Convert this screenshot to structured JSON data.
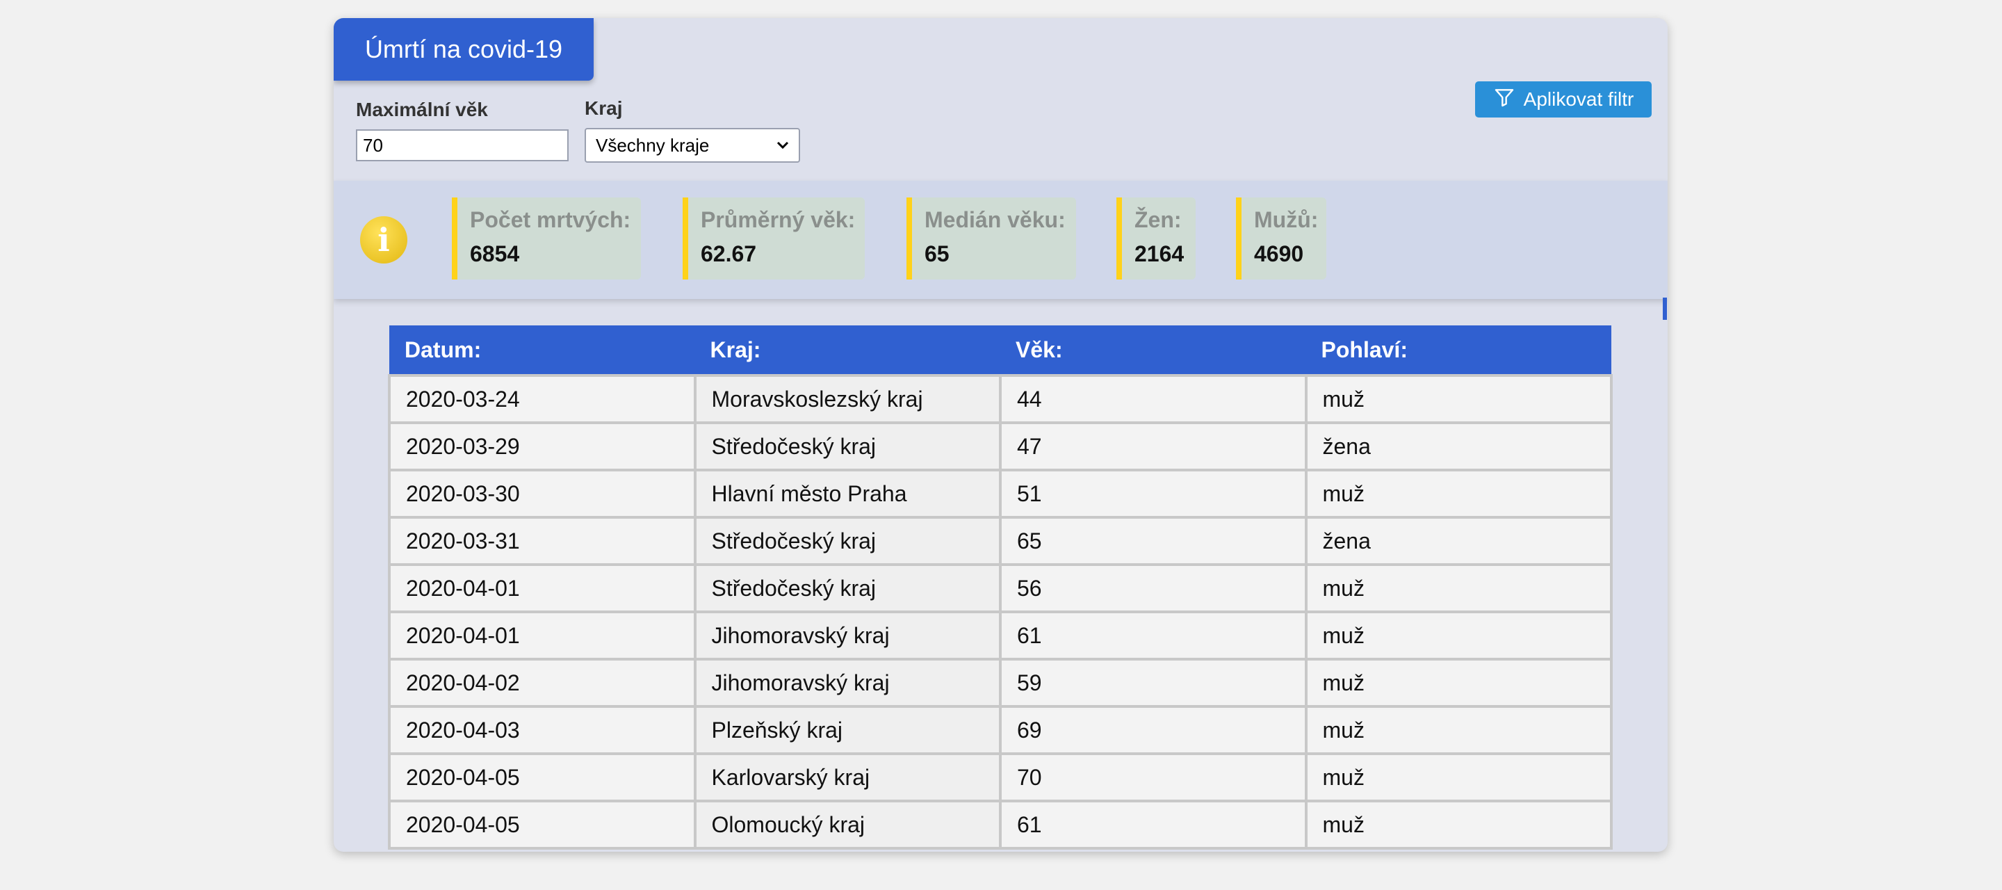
{
  "app": {
    "title": "Úmrtí na covid-19"
  },
  "filters": {
    "max_age_label": "Maximální věk",
    "max_age_value": "70",
    "region_label": "Kraj",
    "region_selected": "Všechny kraje",
    "apply_label": "Aplikovat filtr",
    "apply_icon": "filter-icon"
  },
  "stats": {
    "icon": "info-icon",
    "icon_glyph": "i",
    "items": [
      {
        "label": "Počet mrtvých:",
        "value": "6854"
      },
      {
        "label": "Průměrný věk:",
        "value": "62.67"
      },
      {
        "label": "Medián věku:",
        "value": "65"
      },
      {
        "label": "Žen:",
        "value": "2164"
      },
      {
        "label": "Mužů:",
        "value": "4690"
      }
    ]
  },
  "table": {
    "columns": [
      "Datum:",
      "Kraj:",
      "Věk:",
      "Pohlaví:"
    ],
    "rows": [
      [
        "2020-03-24",
        "Moravskoslezský kraj",
        "44",
        "muž"
      ],
      [
        "2020-03-29",
        "Středočeský kraj",
        "47",
        "žena"
      ],
      [
        "2020-03-30",
        "Hlavní město Praha",
        "51",
        "muž"
      ],
      [
        "2020-03-31",
        "Středočeský kraj",
        "65",
        "žena"
      ],
      [
        "2020-04-01",
        "Středočeský kraj",
        "56",
        "muž"
      ],
      [
        "2020-04-01",
        "Jihomoravský kraj",
        "61",
        "muž"
      ],
      [
        "2020-04-02",
        "Jihomoravský kraj",
        "59",
        "muž"
      ],
      [
        "2020-04-03",
        "Plzeňský kraj",
        "69",
        "muž"
      ],
      [
        "2020-04-05",
        "Karlovarský kraj",
        "70",
        "muž"
      ],
      [
        "2020-04-05",
        "Olomoucký kraj",
        "61",
        "muž"
      ]
    ]
  },
  "colors": {
    "accent": "#3060d0",
    "button": "#2a90d8",
    "stat_border": "#ffd21a",
    "stat_bg": "#cfdcd4"
  }
}
